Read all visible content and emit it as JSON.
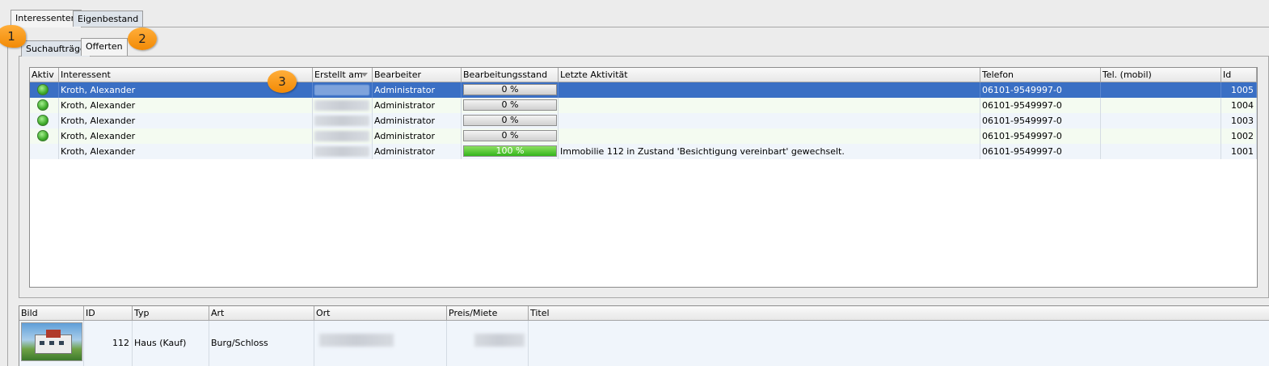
{
  "outer_tabs": [
    "Interessenten",
    "Eigenbestand"
  ],
  "inner_tabs": [
    "Suchaufträge",
    "Offerten"
  ],
  "badges": [
    "1",
    "2",
    "3"
  ],
  "offers_table": {
    "columns": [
      "Aktiv",
      "Interessent",
      "Erstellt am",
      "Bearbeiter",
      "Bearbeitungsstand",
      "Letzte Aktivität",
      "Telefon",
      "Tel. (mobil)",
      "Id"
    ],
    "rows": [
      {
        "active": true,
        "interessent": "Kroth, Alexander",
        "bearbeiter": "Administrator",
        "stand": "0 %",
        "progress": 0,
        "aktivitaet": "",
        "telefon": "06101-9549997-0",
        "mobil": "",
        "id": "1005",
        "selected": true
      },
      {
        "active": true,
        "interessent": "Kroth, Alexander",
        "bearbeiter": "Administrator",
        "stand": "0 %",
        "progress": 0,
        "aktivitaet": "",
        "telefon": "06101-9549997-0",
        "mobil": "",
        "id": "1004",
        "selected": false
      },
      {
        "active": true,
        "interessent": "Kroth, Alexander",
        "bearbeiter": "Administrator",
        "stand": "0 %",
        "progress": 0,
        "aktivitaet": "",
        "telefon": "06101-9549997-0",
        "mobil": "",
        "id": "1003",
        "selected": false
      },
      {
        "active": true,
        "interessent": "Kroth, Alexander",
        "bearbeiter": "Administrator",
        "stand": "0 %",
        "progress": 0,
        "aktivitaet": "",
        "telefon": "06101-9549997-0",
        "mobil": "",
        "id": "1002",
        "selected": false
      },
      {
        "active": false,
        "interessent": "Kroth, Alexander",
        "bearbeiter": "Administrator",
        "stand": "100 %",
        "progress": 100,
        "aktivitaet": "Immobilie 112 in Zustand 'Besichtigung vereinbart' gewechselt.",
        "telefon": "06101-9549997-0",
        "mobil": "",
        "id": "1001",
        "selected": false
      }
    ]
  },
  "property_table": {
    "columns": [
      "Bild",
      "ID",
      "Typ",
      "Art",
      "Ort",
      "Preis/Miete",
      "Titel"
    ],
    "rows": [
      {
        "id": "112",
        "typ": "Haus (Kauf)",
        "art": "Burg/Schloss",
        "ort": "",
        "preis": "",
        "titel": ""
      }
    ]
  },
  "colors": {
    "selection": "#3a6fc4",
    "active_dot": "#3eab2a",
    "badge": "#f28a05"
  }
}
